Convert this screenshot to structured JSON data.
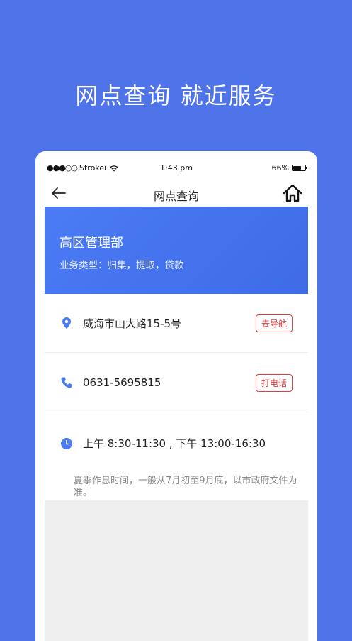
{
  "headline": "网点查询  就近服务",
  "status_bar": {
    "signal_dots": "●●●○○",
    "carrier": "Strokei",
    "time": "1:43 pm",
    "battery_text": "66%",
    "battery_level": 0.66
  },
  "nav": {
    "title": "网点查询"
  },
  "branch": {
    "name": "高区管理部",
    "business_types": "业务类型：归集，提取，贷款"
  },
  "address": {
    "text": "威海市山大路15-5号",
    "button_label": "去导航"
  },
  "phone": {
    "text": "0631-5695815",
    "button_label": "打电话"
  },
  "hours": {
    "text": "上午 8:30-11:30 , 下午 13:00-16:30",
    "note": "夏季作息时间，一般从7月初至9月底，以市政府文件为准。"
  },
  "colors": {
    "background": "#4F73E8",
    "accent": "#4B7BF5",
    "button_red": "#E43B3B"
  }
}
